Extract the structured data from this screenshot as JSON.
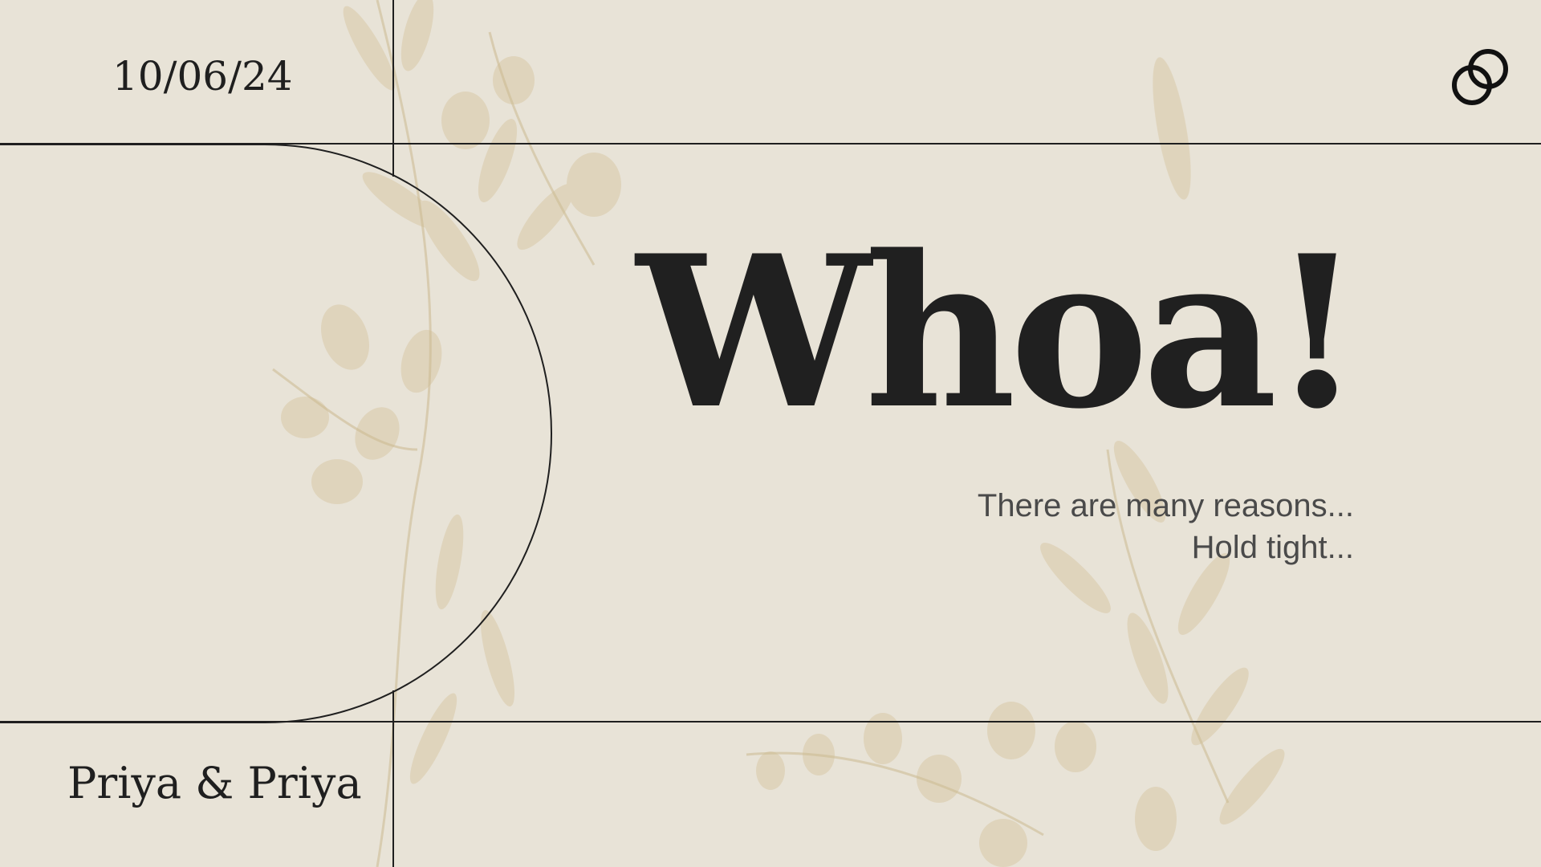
{
  "slide": {
    "date": "10/06/24",
    "couple": "Priya & Priya",
    "headline": "Whoa!",
    "subtext": {
      "line1": "There are many reasons...",
      "line2": "Hold tight..."
    }
  },
  "icons": {
    "top_right": "linked-rings-icon"
  },
  "colors": {
    "background": "#e8e3d7",
    "ink": "#202020",
    "subtext": "#4a4a4a",
    "foliage": "#d8c8a6"
  }
}
